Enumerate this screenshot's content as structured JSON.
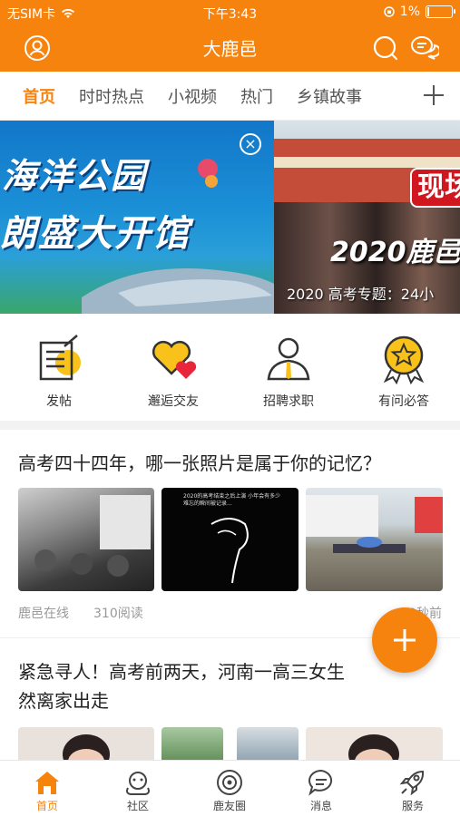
{
  "status_bar": {
    "carrier": "无SIM卡",
    "time": "下午3:43",
    "battery": "1%",
    "battery_level": 0.01
  },
  "header": {
    "title": "大鹿邑"
  },
  "tabs": [
    {
      "label": "首页",
      "active": true
    },
    {
      "label": "时时热点",
      "active": false
    },
    {
      "label": "小视频",
      "active": false
    },
    {
      "label": "热门",
      "active": false
    },
    {
      "label": "乡镇故事",
      "active": false
    }
  ],
  "banner": {
    "slide1_line1": "海洋公园",
    "slide1_line2": "朗盛大开馆",
    "slide2_tag": "现场",
    "slide2_headline": "2020鹿邑",
    "slide2_caption": "2020 高考专题：24小"
  },
  "shortcuts": [
    {
      "label": "发帖",
      "icon": "post-note-icon"
    },
    {
      "label": "邂逅交友",
      "icon": "heart-friends-icon"
    },
    {
      "label": "招聘求职",
      "icon": "job-person-icon"
    },
    {
      "label": "有问必答",
      "icon": "star-badge-icon"
    }
  ],
  "articles": [
    {
      "title": "高考四十四年，哪一张照片是属于你的记忆？",
      "source": "鹿邑在线",
      "reads": "310阅读",
      "time": "49秒前",
      "thumb2_text": "2020的高考结束之后上演 小年会有多少难忘的瞬间被记录..."
    },
    {
      "title_line1": "紧急寻人！高考前两天，河南一高三女生",
      "title_line2": "然离家出走"
    }
  ],
  "bottom_nav": [
    {
      "label": "首页",
      "icon": "home-icon",
      "active": true
    },
    {
      "label": "社区",
      "icon": "community-icon",
      "active": false
    },
    {
      "label": "鹿友圈",
      "icon": "friends-circle-icon",
      "active": false
    },
    {
      "label": "消息",
      "icon": "message-icon",
      "active": false
    },
    {
      "label": "服务",
      "icon": "service-rocket-icon",
      "active": false
    }
  ],
  "colors": {
    "accent": "#f7830f",
    "text": "#222222",
    "muted": "#999999"
  }
}
